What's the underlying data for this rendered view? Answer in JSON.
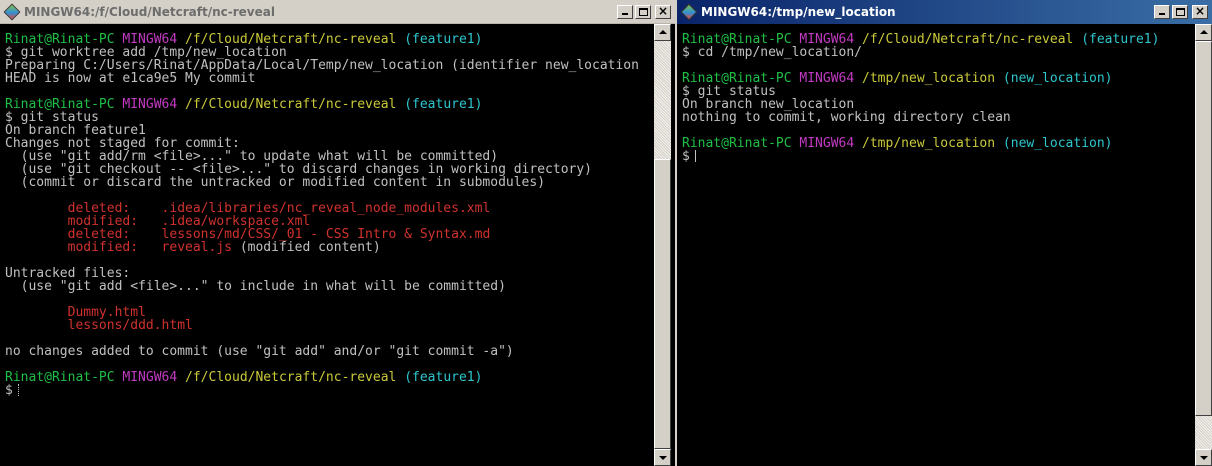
{
  "left_window": {
    "title": "MINGW64:/f/Cloud/Netcraft/nc-reveal",
    "lines": [
      [
        [
          "prompt_user",
          "Rinat@Rinat-PC"
        ],
        [
          "text",
          " "
        ],
        [
          "prompt_msys",
          "MINGW64"
        ],
        [
          "text",
          " "
        ],
        [
          "prompt_path",
          "/f/Cloud/Netcraft/nc-reveal"
        ],
        [
          "text",
          " "
        ],
        [
          "prompt_branch",
          "(feature1)"
        ]
      ],
      [
        [
          "text",
          "$ git worktree add /tmp/new_location"
        ]
      ],
      [
        [
          "text",
          "Preparing C:/Users/Rinat/AppData/Local/Temp/new_location (identifier new_location"
        ]
      ],
      [
        [
          "text",
          "HEAD is now at e1ca9e5 My commit"
        ]
      ],
      [
        [
          "text",
          ""
        ]
      ],
      [
        [
          "prompt_user",
          "Rinat@Rinat-PC"
        ],
        [
          "text",
          " "
        ],
        [
          "prompt_msys",
          "MINGW64"
        ],
        [
          "text",
          " "
        ],
        [
          "prompt_path",
          "/f/Cloud/Netcraft/nc-reveal"
        ],
        [
          "text",
          " "
        ],
        [
          "prompt_branch",
          "(feature1)"
        ]
      ],
      [
        [
          "text",
          "$ git status"
        ]
      ],
      [
        [
          "text",
          "On branch feature1"
        ]
      ],
      [
        [
          "text",
          "Changes not staged for commit:"
        ]
      ],
      [
        [
          "text",
          "  (use \"git add/rm <file>...\" to update what will be committed)"
        ]
      ],
      [
        [
          "text",
          "  (use \"git checkout -- <file>...\" to discard changes in working directory)"
        ]
      ],
      [
        [
          "text",
          "  (commit or discard the untracked or modified content in submodules)"
        ]
      ],
      [
        [
          "text",
          ""
        ]
      ],
      [
        [
          "text",
          "        "
        ],
        [
          "red",
          "deleted:    .idea/libraries/nc_reveal_node_modules.xml"
        ]
      ],
      [
        [
          "text",
          "        "
        ],
        [
          "red",
          "modified:   .idea/workspace.xml"
        ]
      ],
      [
        [
          "text",
          "        "
        ],
        [
          "red",
          "deleted:    lessons/md/CSS/_01 - CSS Intro & Syntax.md"
        ]
      ],
      [
        [
          "text",
          "        "
        ],
        [
          "red",
          "modified:   reveal.js"
        ],
        [
          "text",
          " (modified content)"
        ]
      ],
      [
        [
          "text",
          ""
        ]
      ],
      [
        [
          "text",
          "Untracked files:"
        ]
      ],
      [
        [
          "text",
          "  (use \"git add <file>...\" to include in what will be committed)"
        ]
      ],
      [
        [
          "text",
          ""
        ]
      ],
      [
        [
          "text",
          "        "
        ],
        [
          "red",
          "Dummy.html"
        ]
      ],
      [
        [
          "text",
          "        "
        ],
        [
          "red",
          "lessons/ddd.html"
        ]
      ],
      [
        [
          "text",
          ""
        ]
      ],
      [
        [
          "text",
          "no changes added to commit (use \"git add\" and/or \"git commit -a\")"
        ]
      ],
      [
        [
          "text",
          ""
        ]
      ],
      [
        [
          "prompt_user",
          "Rinat@Rinat-PC"
        ],
        [
          "text",
          " "
        ],
        [
          "prompt_msys",
          "MINGW64"
        ],
        [
          "text",
          " "
        ],
        [
          "prompt_path",
          "/f/Cloud/Netcraft/nc-reveal"
        ],
        [
          "text",
          " "
        ],
        [
          "prompt_branch",
          "(feature1)"
        ]
      ],
      [
        [
          "text",
          "$"
        ],
        [
          "cursor_dotted",
          ""
        ]
      ]
    ]
  },
  "right_window": {
    "title": "MINGW64:/tmp/new_location",
    "lines": [
      [
        [
          "prompt_user",
          "Rinat@Rinat-PC"
        ],
        [
          "text",
          " "
        ],
        [
          "prompt_msys",
          "MINGW64"
        ],
        [
          "text",
          " "
        ],
        [
          "prompt_path",
          "/f/Cloud/Netcraft/nc-reveal"
        ],
        [
          "text",
          " "
        ],
        [
          "prompt_branch",
          "(feature1)"
        ]
      ],
      [
        [
          "text",
          "$ cd /tmp/new_location/"
        ]
      ],
      [
        [
          "text",
          ""
        ]
      ],
      [
        [
          "prompt_user",
          "Rinat@Rinat-PC"
        ],
        [
          "text",
          " "
        ],
        [
          "prompt_msys",
          "MINGW64"
        ],
        [
          "text",
          " "
        ],
        [
          "prompt_path",
          "/tmp/new_location"
        ],
        [
          "text",
          " "
        ],
        [
          "prompt_branch",
          "(new_location)"
        ]
      ],
      [
        [
          "text",
          "$ git status"
        ]
      ],
      [
        [
          "text",
          "On branch new_location"
        ]
      ],
      [
        [
          "text",
          "nothing to commit, working directory clean"
        ]
      ],
      [
        [
          "text",
          ""
        ]
      ],
      [
        [
          "prompt_user",
          "Rinat@Rinat-PC"
        ],
        [
          "text",
          " "
        ],
        [
          "prompt_msys",
          "MINGW64"
        ],
        [
          "text",
          " "
        ],
        [
          "prompt_path",
          "/tmp/new_location"
        ],
        [
          "text",
          " "
        ],
        [
          "prompt_branch",
          "(new_location)"
        ]
      ],
      [
        [
          "text",
          "$"
        ],
        [
          "cursor_bar",
          ""
        ]
      ]
    ]
  },
  "icons": {
    "app": "mingw-app-icon",
    "minimize": "minimize-icon",
    "maximize": "maximize-icon",
    "close": "close-icon"
  },
  "close_glyph": "×",
  "colors": {
    "prompt_user": "#1fbf46",
    "prompt_msys": "#c23ac2",
    "prompt_path": "#c9c93a",
    "prompt_branch": "#2ec6ce",
    "red": "#d0322e",
    "text": "#c0c0c0",
    "background": "#000000",
    "active_title": "#0a246a"
  }
}
